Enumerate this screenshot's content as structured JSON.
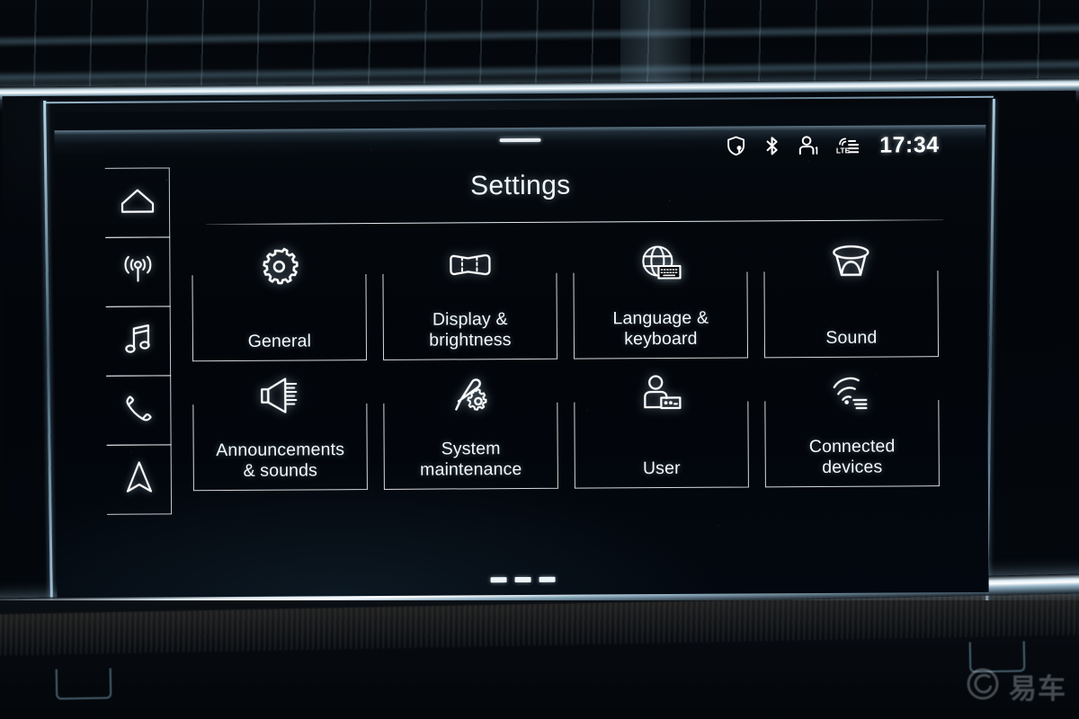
{
  "screen": {
    "title": "Settings",
    "statusbar": {
      "icons": [
        {
          "name": "privacy-shield-location-icon",
          "glyph": "shield-pin"
        },
        {
          "name": "bluetooth-icon",
          "glyph": "bluetooth"
        },
        {
          "name": "user-profile-icon",
          "glyph": "person-1",
          "badge": "1"
        },
        {
          "name": "lte-signal-icon",
          "glyph": "lte-bars",
          "label": "LTE"
        }
      ],
      "clock": "17:34"
    },
    "pull_handle": {
      "name": "status-pull-handle"
    }
  },
  "sidebar": {
    "items": [
      {
        "name": "sidebar-item-home",
        "icon": "home-icon",
        "label": "Home"
      },
      {
        "name": "sidebar-item-radio",
        "icon": "radio-antenna-icon",
        "label": "Radio"
      },
      {
        "name": "sidebar-item-media",
        "icon": "music-note-icon",
        "label": "Media"
      },
      {
        "name": "sidebar-item-phone",
        "icon": "phone-handset-icon",
        "label": "Phone"
      },
      {
        "name": "sidebar-item-navigation",
        "icon": "navigation-arrow-icon",
        "label": "Navigation"
      }
    ]
  },
  "menu": {
    "tiles": [
      {
        "id": "general",
        "label": "General",
        "icon": "gear-icon"
      },
      {
        "id": "display-brightness",
        "label": "Display &\nbrightness",
        "icon": "display-screen-icon"
      },
      {
        "id": "language-keyboard",
        "label": "Language &\nkeyboard",
        "icon": "globe-keyboard-icon"
      },
      {
        "id": "sound",
        "label": "Sound",
        "icon": "speaker-cone-icon"
      },
      {
        "id": "announcements",
        "label": "Announcements\n& sounds",
        "icon": "megaphone-icon"
      },
      {
        "id": "system-maintenance",
        "label": "System\nmaintenance",
        "icon": "screwdriver-gear-icon"
      },
      {
        "id": "user",
        "label": "User",
        "icon": "person-card-icon"
      },
      {
        "id": "connected-devices",
        "label": "Connected\ndevices",
        "icon": "wireless-signal-icon"
      }
    ]
  },
  "pagination": {
    "pages": 3,
    "current": 1,
    "style": "dashes"
  },
  "watermark": {
    "text": "易车",
    "mark": "yiche-logo"
  },
  "colors": {
    "ui_text": "#f4f9fc",
    "ui_background": "#02050a",
    "tile_border": "#f0f7fc",
    "chrome_trim": "#e6f2fa",
    "accent_glow": "#9fcde8"
  }
}
